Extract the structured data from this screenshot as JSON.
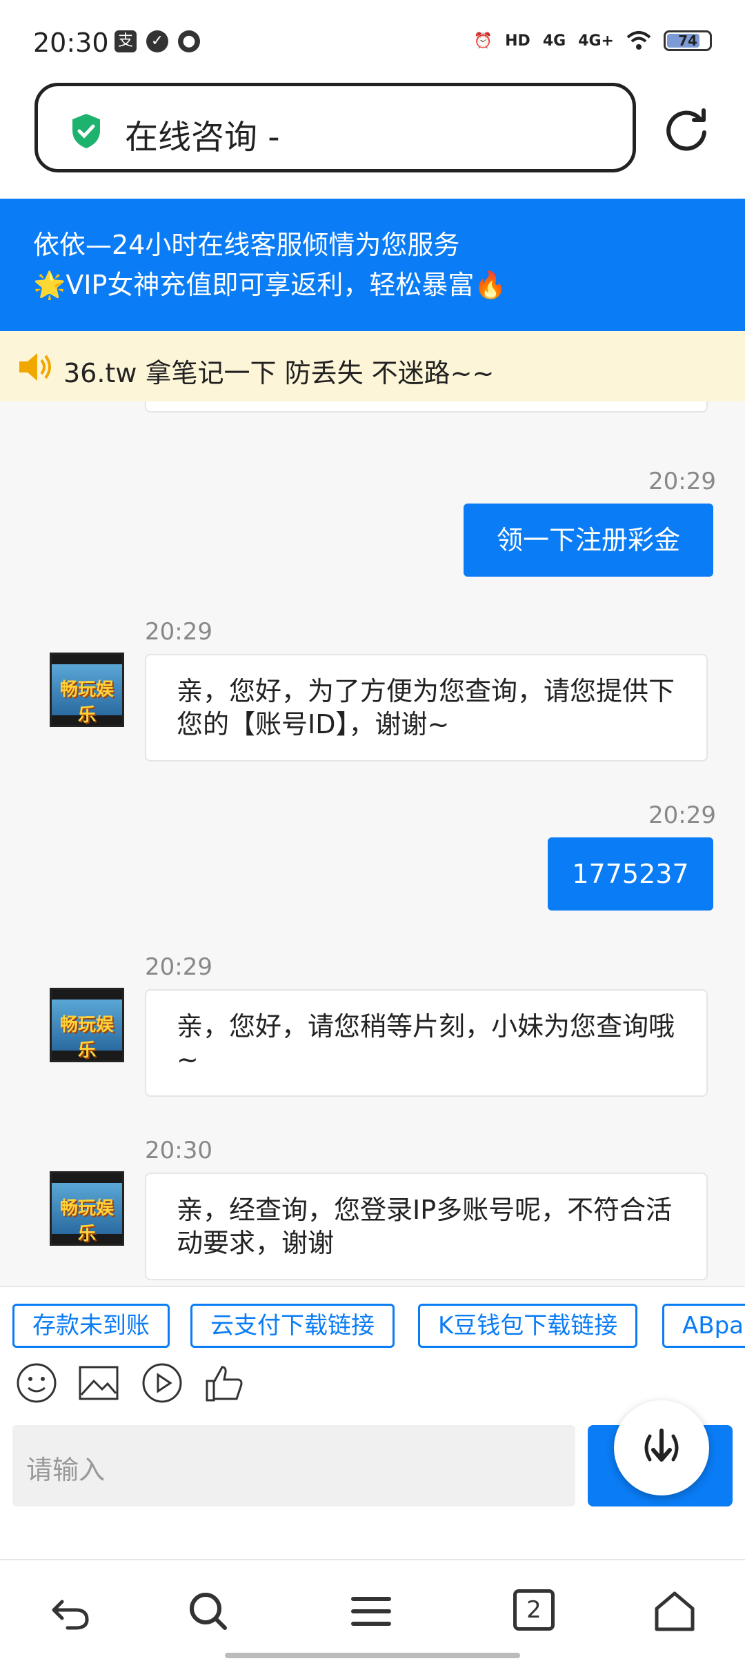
{
  "status_bar": {
    "time": "20:30",
    "battery": "74",
    "network_labels": [
      "HD",
      "4G",
      "4G+"
    ]
  },
  "url_bar": {
    "title": "在线咨询 -"
  },
  "banner": {
    "line1": "依依—24小时在线客服倾情为您服务",
    "line2": "🌟VIP女神充值即可享返利，轻松暴富🔥"
  },
  "notice": {
    "text": "36.tw 拿笔记一下 防丢失 不迷路~~"
  },
  "messages": [
    {
      "from": "user",
      "time": "20:29",
      "text": "领一下注册彩金"
    },
    {
      "from": "agent",
      "time": "20:29",
      "text": "亲，您好，为了方便为您查询，请您提供下您的【账号ID】，谢谢~"
    },
    {
      "from": "user",
      "time": "20:29",
      "text": "1775237"
    },
    {
      "from": "agent",
      "time": "20:29",
      "text": "亲，您好，请您稍等片刻，小妹为您查询哦~"
    },
    {
      "from": "agent",
      "time": "20:30",
      "text": "亲，经查询，您登录IP多账号呢，不符合活动要求，谢谢"
    }
  ],
  "avatar_text": "畅玩娱乐",
  "quick_replies": [
    "存款未到账",
    "云支付下载链接",
    "K豆钱包下载链接",
    "ABpa"
  ],
  "tools": [
    "emoji-icon",
    "image-icon",
    "video-icon",
    "thumbs-up-icon"
  ],
  "input": {
    "placeholder": "请输入"
  },
  "nav": {
    "tab_count": "2",
    "icons": [
      "back-icon",
      "search-icon",
      "menu-icon",
      "tabs-icon",
      "home-icon"
    ]
  },
  "colors": {
    "accent": "#0a7cf5",
    "notice_bg": "#fdf5d8",
    "chat_bg": "#f7f7f7"
  }
}
